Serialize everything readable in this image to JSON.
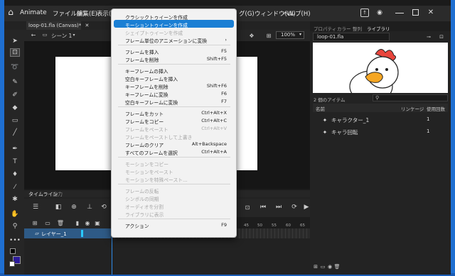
{
  "app": {
    "title": "Animate",
    "menus": [
      "ファイル(F)",
      "編集(E)",
      "表示(V)",
      "グ(G)",
      "ウィンドウ(W)",
      "ヘルプ(H)"
    ]
  },
  "document": {
    "tab_label": "loop-01.fla (Canvas)*",
    "scene_label": "シーン 1",
    "zoom": "100%"
  },
  "timeline": {
    "tabs": [
      "タイムライン",
      "出力"
    ],
    "layer_name": "レイヤー_1",
    "ruler_numbers": [
      "45",
      "50",
      "55",
      "60",
      "65"
    ]
  },
  "library": {
    "tabs": [
      "プロパティ",
      "カラー",
      "整列",
      "ライブラリ"
    ],
    "active_tab_index": 3,
    "doc_name": "loop-01.fla",
    "items_count": "2 個のアイテム",
    "columns": {
      "name": "名前",
      "linkage": "リンケージ",
      "use_count": "使用回数"
    },
    "items": [
      {
        "name": "キャラクター_1",
        "count": "1",
        "icon": "movieclip-icon"
      },
      {
        "name": "キャラ回転",
        "count": "1",
        "icon": "movieclip-icon"
      }
    ]
  },
  "context_menu": {
    "items": [
      {
        "label": "クラシックトゥイーンを作成",
        "shortcut": "",
        "state": "normal"
      },
      {
        "label": "モーショントゥイーンを作成",
        "shortcut": "",
        "state": "highlighted"
      },
      {
        "label": "シェイプトゥイーンを作成",
        "shortcut": "",
        "state": "disabled"
      },
      {
        "label": "フレーム単位のアニメーションに変換",
        "shortcut": "›",
        "state": "normal"
      },
      {
        "separator": true
      },
      {
        "label": "フレームを挿入",
        "shortcut": "F5",
        "state": "normal"
      },
      {
        "label": "フレームを削除",
        "shortcut": "Shift+F5",
        "state": "normal"
      },
      {
        "separator": true
      },
      {
        "label": "キーフレームの挿入",
        "shortcut": "",
        "state": "normal"
      },
      {
        "label": "空白キーフレームを挿入",
        "shortcut": "",
        "state": "normal"
      },
      {
        "label": "キーフレームを削除",
        "shortcut": "Shift+F6",
        "state": "normal"
      },
      {
        "label": "キーフレームに変換",
        "shortcut": "F6",
        "state": "normal"
      },
      {
        "label": "空白キーフレームに変換",
        "shortcut": "F7",
        "state": "normal"
      },
      {
        "separator": true
      },
      {
        "label": "フレームをカット",
        "shortcut": "Ctrl+Alt+X",
        "state": "normal"
      },
      {
        "label": "フレームをコピー",
        "shortcut": "Ctrl+Alt+C",
        "state": "normal"
      },
      {
        "label": "フレームをペースト",
        "shortcut": "Ctrl+Alt+V",
        "state": "disabled"
      },
      {
        "label": "フレームをペーストして上書き",
        "shortcut": "",
        "state": "disabled"
      },
      {
        "label": "フレームのクリア",
        "shortcut": "Alt+Backspace",
        "state": "normal"
      },
      {
        "label": "すべてのフレームを選択",
        "shortcut": "Ctrl+Alt+A",
        "state": "normal"
      },
      {
        "separator": true
      },
      {
        "label": "モーションをコピー",
        "shortcut": "",
        "state": "disabled"
      },
      {
        "label": "モーションをペースト",
        "shortcut": "",
        "state": "disabled"
      },
      {
        "label": "モーションを特殊ペースト...",
        "shortcut": "",
        "state": "disabled"
      },
      {
        "separator": true
      },
      {
        "label": "フレームの反転",
        "shortcut": "",
        "state": "disabled"
      },
      {
        "label": "シンボルの同期",
        "shortcut": "",
        "state": "disabled"
      },
      {
        "label": "オーディオを分割",
        "shortcut": "",
        "state": "disabled"
      },
      {
        "label": "ライブラリに表示",
        "shortcut": "",
        "state": "disabled"
      },
      {
        "separator": true
      },
      {
        "label": "アクション",
        "shortcut": "F9",
        "state": "normal"
      }
    ]
  },
  "colors": {
    "accent": "#1a7fd4",
    "desktop": "#1f6fd1",
    "panel_bg": "#232323",
    "stage": "#ffffff",
    "layer_selected": "#2e5a86"
  }
}
